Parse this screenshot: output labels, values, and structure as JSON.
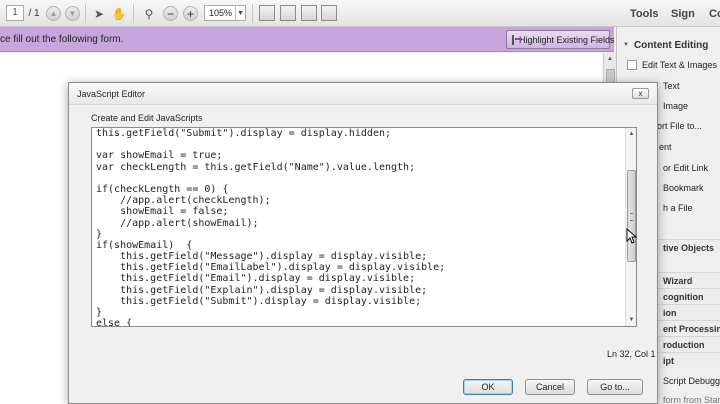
{
  "toolbar": {
    "page_number": "1",
    "page_total": "/ 1",
    "zoom": "105%",
    "tabs": [
      "Tools",
      "Sign",
      "Co"
    ]
  },
  "form_bar": {
    "message": "ce fill out the following form.",
    "highlight_button": "Highlight Existing Fields"
  },
  "right_pane": {
    "section_header": "Content Editing",
    "items": [
      "Edit Text & Images",
      "Text",
      "Image",
      "ort File to...",
      "ent",
      "or Edit Link",
      "Bookmark",
      "h a File"
    ],
    "sections": [
      "tive Objects",
      "Wizard",
      "cognition",
      "ion",
      "ent Processing",
      "roduction",
      "ipt",
      "Script Debugger",
      "form from Start"
    ]
  },
  "dialog": {
    "title": "JavaScript Editor",
    "close": "x",
    "subtitle": "Create and Edit JavaScripts",
    "code_lines": [
      "this.getField(\"Submit\").display = display.hidden;",
      "",
      "var showEmail = true;",
      "var checkLength = this.getField(\"Name\").value.length;",
      "",
      "if(checkLength == 0) {",
      "    //app.alert(checkLength);",
      "    showEmail = false;",
      "    //app.alert(showEmail);",
      "}",
      "if(showEmail)  {",
      "    this.getField(\"Message\").display = display.visible;",
      "    this.getField(\"EmailLabel\").display = display.visible;",
      "    this.getField(\"Email\").display = display.visible;",
      "    this.getField(\"Explain\").display = display.visible;",
      "    this.getField(\"Submit\").display = display.visible;",
      "}",
      "else {"
    ],
    "cursor_position": "Ln 32, Col 1",
    "buttons": {
      "ok": "OK",
      "cancel": "Cancel",
      "goto": "Go to..."
    }
  },
  "colors": {
    "form_bar": "#c7a6dd",
    "dialog_bg": "#f0f0f0",
    "default_button_border": "#3c7fb1"
  },
  "icons": [
    "select-arrow-icon",
    "hand-icon",
    "marquee-zoom-icon",
    "zoom-out-icon",
    "zoom-in-icon",
    "fit-page-icon",
    "fit-width-icon",
    "highlight-fields-icon",
    "close-icon"
  ]
}
